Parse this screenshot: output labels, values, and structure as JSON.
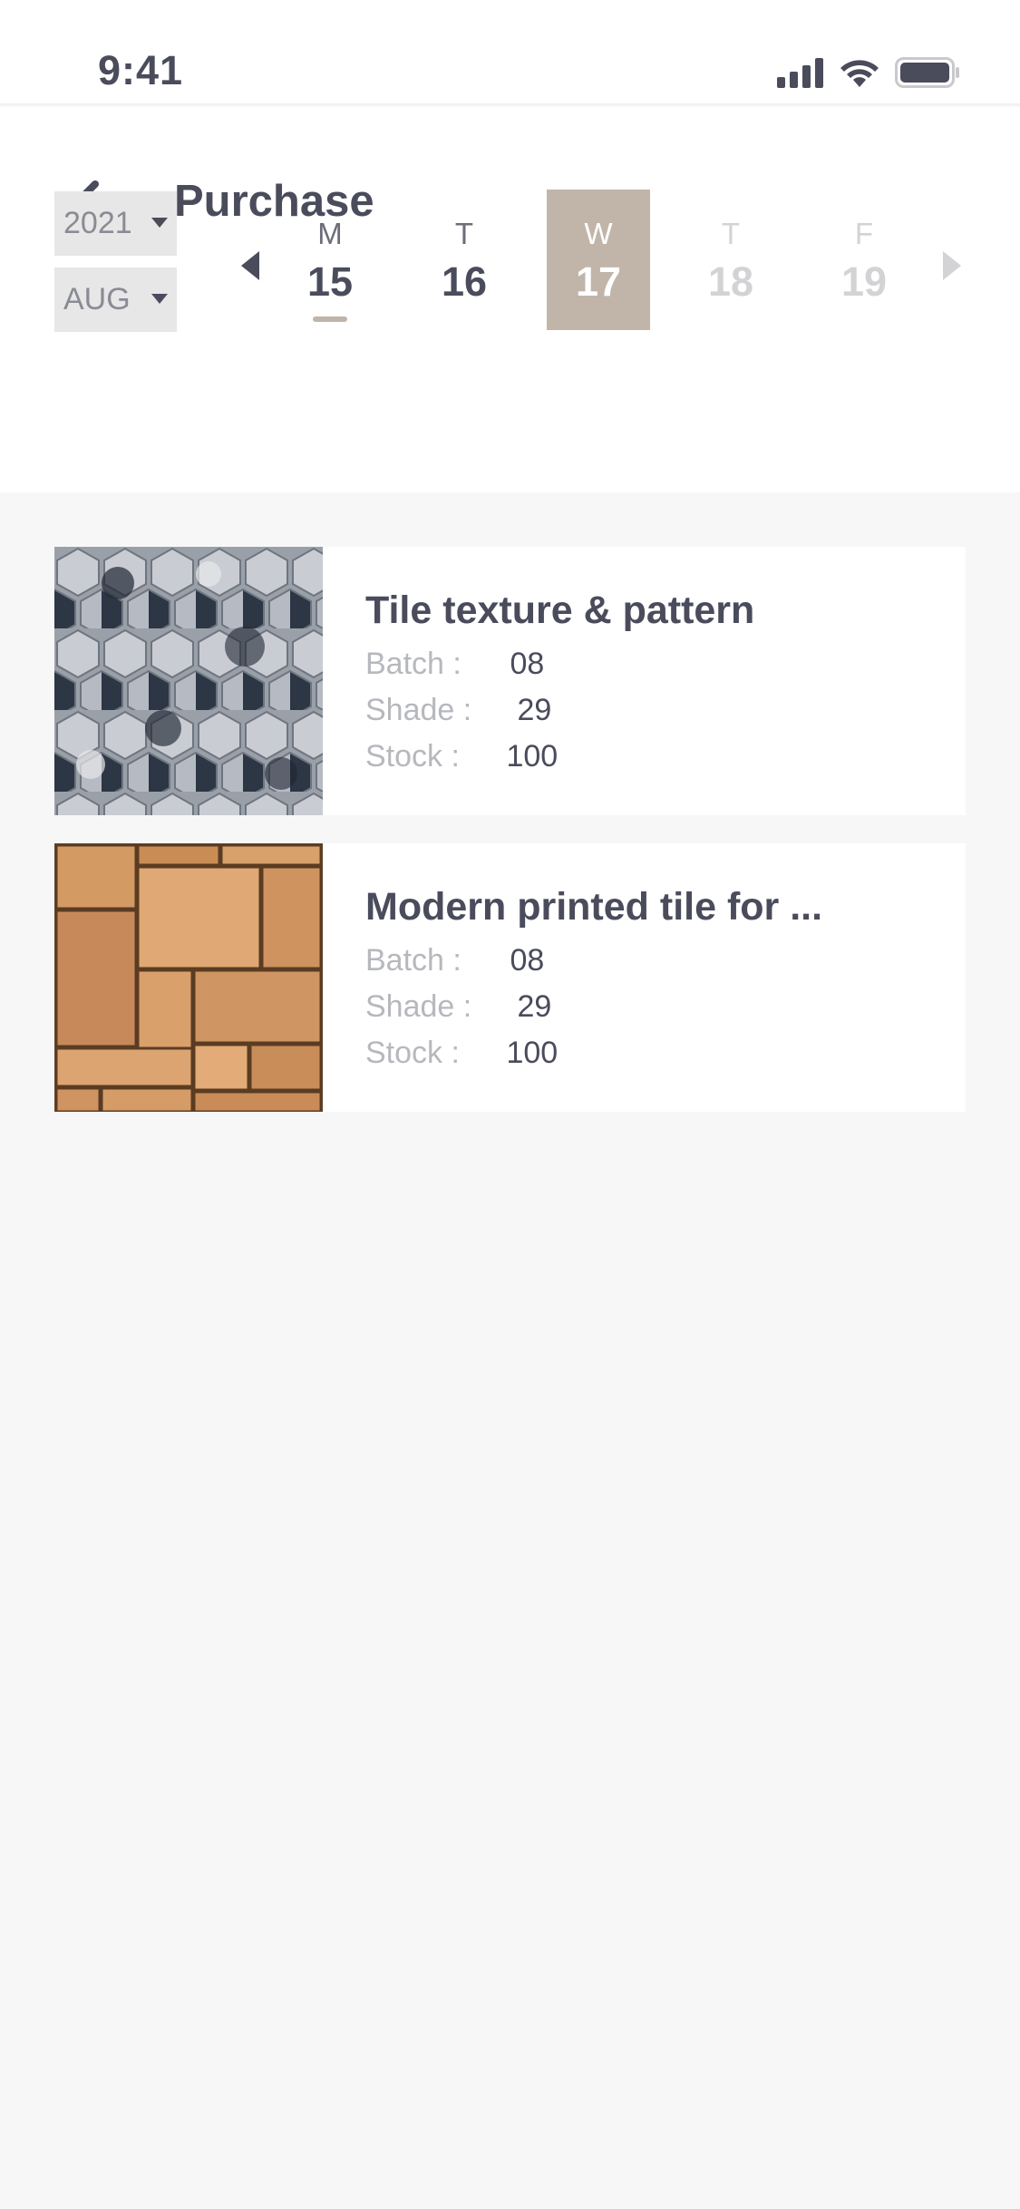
{
  "status_bar": {
    "time": "9:41"
  },
  "header": {
    "title": "Purchase"
  },
  "filters": {
    "year": "2021",
    "month": "AUG"
  },
  "calendar": {
    "days": [
      {
        "dow": "M",
        "num": "15",
        "state": "today"
      },
      {
        "dow": "T",
        "num": "16",
        "state": "normal"
      },
      {
        "dow": "W",
        "num": "17",
        "state": "selected"
      },
      {
        "dow": "T",
        "num": "18",
        "state": "disabled"
      },
      {
        "dow": "F",
        "num": "19",
        "state": "disabled"
      }
    ]
  },
  "products": [
    {
      "title": "Tile texture & pattern",
      "batch_label": "Batch :",
      "batch": "08",
      "shade_label": "Shade :",
      "shade": "29",
      "stock_label": "Stock :",
      "stock": "100"
    },
    {
      "title": "Modern printed tile for ...",
      "batch_label": "Batch :",
      "batch": "08",
      "shade_label": "Shade :",
      "shade": "29",
      "stock_label": "Stock :",
      "stock": "100"
    }
  ],
  "colors": {
    "accent": "#c1b5aa",
    "text_dark": "#4a4c5c",
    "text_muted": "#b7b8be",
    "background": "#f7f7f7"
  }
}
